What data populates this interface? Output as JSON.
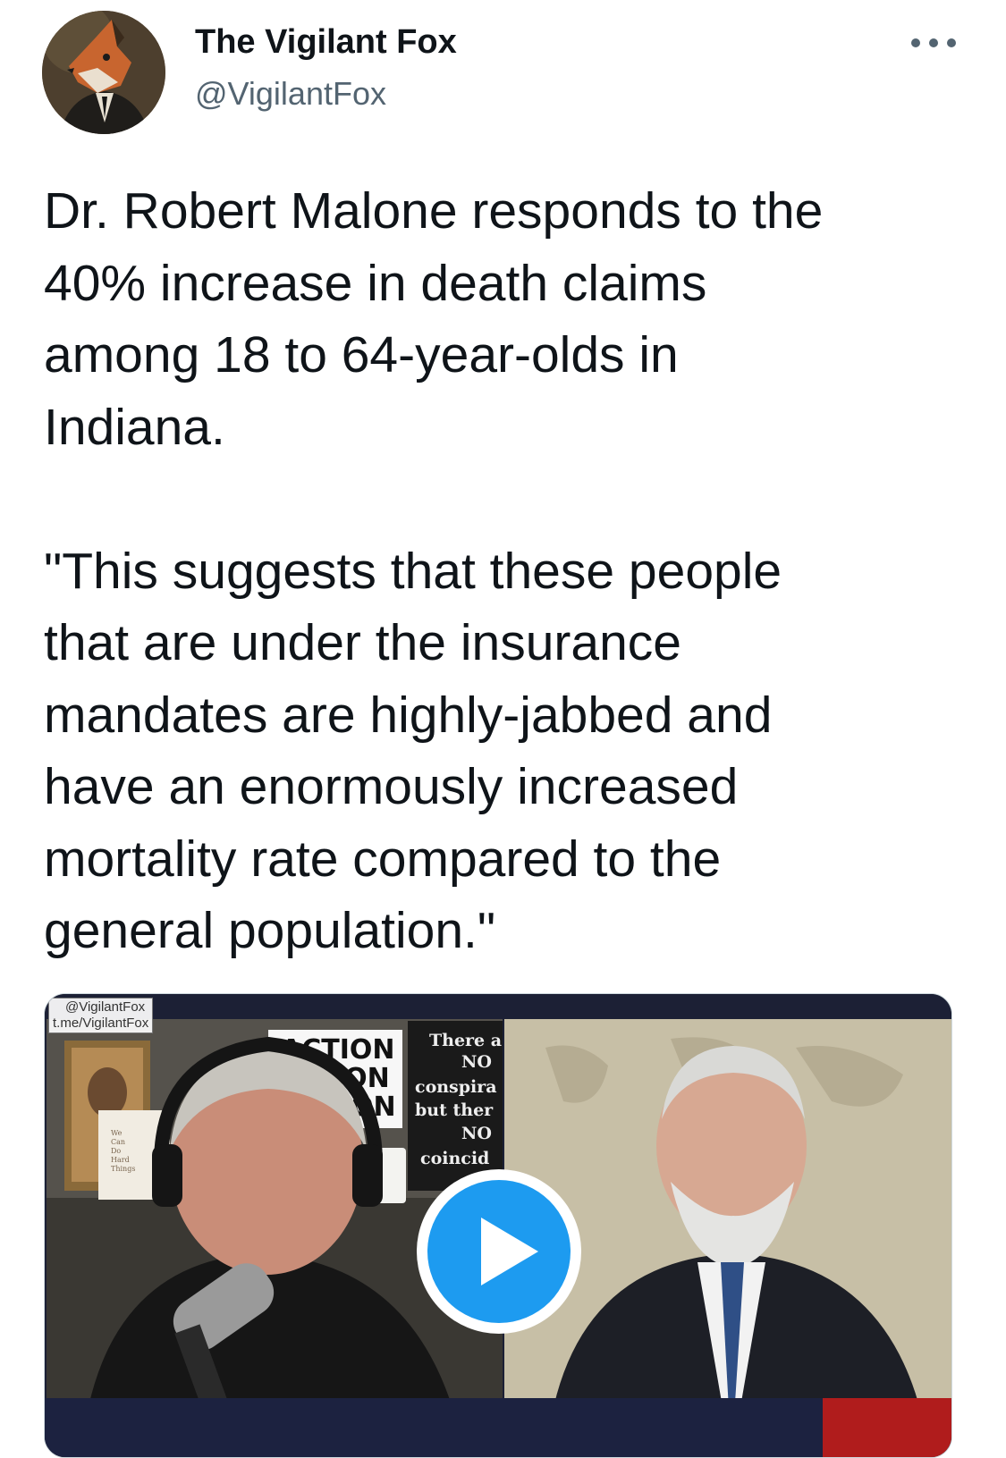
{
  "author": {
    "display_name": "The Vigilant Fox",
    "handle": "@VigilantFox",
    "avatar_icon": "fox-avatar"
  },
  "header": {
    "more_icon": "more-horizontal-icon"
  },
  "tweet": {
    "text": "Dr. Robert Malone responds to the\n40% increase in death claims\namong 18 to 64-year-olds in\nIndiana.\n\n\"This suggests that these people\nthat are under the insurance\nmandates are highly-jabbed and\nhave an enormously increased\nmortality rate compared to the\ngeneral population.\""
  },
  "media": {
    "type": "video",
    "watermark_handle": "@VigilantFox",
    "watermark_link": "t.me/VigilantFox",
    "sign_left_lines": [
      "ACTION",
      "ION",
      "ON"
    ],
    "sign_right_lines": [
      "There a",
      "NO",
      "conspira",
      "but ther",
      "NO",
      "coincid"
    ],
    "poster_small_text": [
      "We",
      "Can",
      "Do",
      "Hard",
      "Things"
    ],
    "play_icon": "play-icon",
    "colors": {
      "play_blue": "#1d9bf0",
      "background": "#1a1e2b"
    }
  }
}
